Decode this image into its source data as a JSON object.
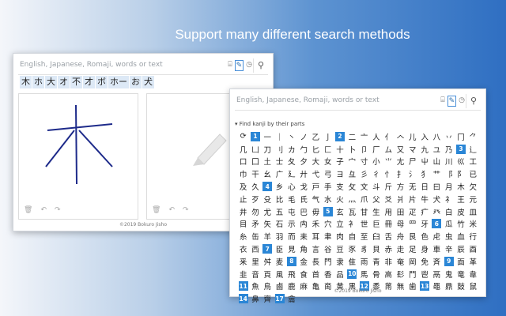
{
  "headline": "Support many different search methods",
  "window1": {
    "search_placeholder": "English, Japanese, Romaji, words or text",
    "candidates": [
      "木",
      "ホ",
      "大",
      "オ",
      "不",
      "才",
      "ボ",
      "ホー",
      "お",
      "犬"
    ],
    "footer": "©2019 Bokuro Jisho"
  },
  "window2": {
    "search_placeholder": "English, Japanese, Romaji, words or text",
    "find_kanji_label": "Find kanji by their parts",
    "footer": "©2019 Bokuro Jisho",
    "radical_rows": [
      [
        "⟳",
        "1",
        "一",
        "｜",
        "丶",
        "ノ",
        "乙",
        "亅",
        "2",
        "二",
        "亠",
        "人",
        "亻",
        "𠆢",
        "儿",
        "入",
        "八",
        "丷",
        "冂",
        "⺈"
      ],
      [
        "几",
        "凵",
        "刀",
        "刂",
        "カ",
        "勹",
        "匕",
        "匚",
        "十",
        "卜",
        "卩",
        "厂",
        "ム",
        "又",
        "マ",
        "九",
        "ユ",
        "乃",
        "3",
        "⻌"
      ],
      [
        "口",
        "囗",
        "土",
        "士",
        "夂",
        "夕",
        "大",
        "女",
        "子",
        "宀",
        "寸",
        "小",
        "⺌",
        "尢",
        "尸",
        "屮",
        "山",
        "川",
        "巛",
        "工"
      ],
      [
        "巾",
        "干",
        "幺",
        "广",
        "廴",
        "廾",
        "弋",
        "弓",
        "ヨ",
        "彑",
        "彡",
        "彳",
        "⺖",
        "⺘",
        "⺡",
        "犭",
        "⺾",
        "⻏",
        "⻖",
        "已"
      ],
      [
        "及",
        "久",
        "4",
        "乡",
        "心",
        "戈",
        "戸",
        "手",
        "支",
        "攵",
        "文",
        "斗",
        "斤",
        "方",
        "无",
        "日",
        "曰",
        "月",
        "木",
        "欠"
      ],
      [
        "止",
        "歹",
        "殳",
        "比",
        "毛",
        "氏",
        "气",
        "水",
        "火",
        "⺣",
        "爪",
        "父",
        "爻",
        "爿",
        "片",
        "牛",
        "犬",
        "⺭",
        "王",
        "元"
      ],
      [
        "井",
        "勿",
        "尤",
        "五",
        "屯",
        "巴",
        "毋",
        "5",
        "玄",
        "瓦",
        "甘",
        "生",
        "用",
        "田",
        "疋",
        "疒",
        "癶",
        "白",
        "皮",
        "皿"
      ],
      [
        "目",
        "矛",
        "矢",
        "石",
        "示",
        "禸",
        "禾",
        "穴",
        "立",
        "⻂",
        "世",
        "巨",
        "冊",
        "母",
        "⺲",
        "牙",
        "6",
        "瓜",
        "竹",
        "米"
      ],
      [
        "糸",
        "缶",
        "羊",
        "羽",
        "而",
        "耒",
        "耳",
        "聿",
        "肉",
        "自",
        "至",
        "臼",
        "舌",
        "舟",
        "艮",
        "色",
        "虍",
        "虫",
        "血",
        "行"
      ],
      [
        "衣",
        "西",
        "7",
        "臣",
        "見",
        "角",
        "言",
        "谷",
        "豆",
        "豕",
        "豸",
        "貝",
        "赤",
        "走",
        "足",
        "身",
        "車",
        "辛",
        "辰",
        "酉"
      ],
      [
        "釆",
        "里",
        "舛",
        "麦",
        "8",
        "金",
        "長",
        "門",
        "隶",
        "隹",
        "雨",
        "青",
        "非",
        "奄",
        "岡",
        "免",
        "斉",
        "9",
        "面",
        "革"
      ],
      [
        "韭",
        "音",
        "頁",
        "風",
        "飛",
        "食",
        "首",
        "香",
        "品",
        "10",
        "馬",
        "骨",
        "高",
        "髟",
        "鬥",
        "鬯",
        "鬲",
        "鬼",
        "竜",
        "韋"
      ],
      [
        "11",
        "魚",
        "鳥",
        "鹵",
        "鹿",
        "麻",
        "亀",
        "啇",
        "黄",
        "黒",
        "12",
        "黍",
        "黹",
        "無",
        "歯",
        "13",
        "黽",
        "鼎",
        "鼓",
        "鼠"
      ],
      [
        "14",
        "鼻",
        "齊",
        "17",
        "龠"
      ]
    ]
  }
}
